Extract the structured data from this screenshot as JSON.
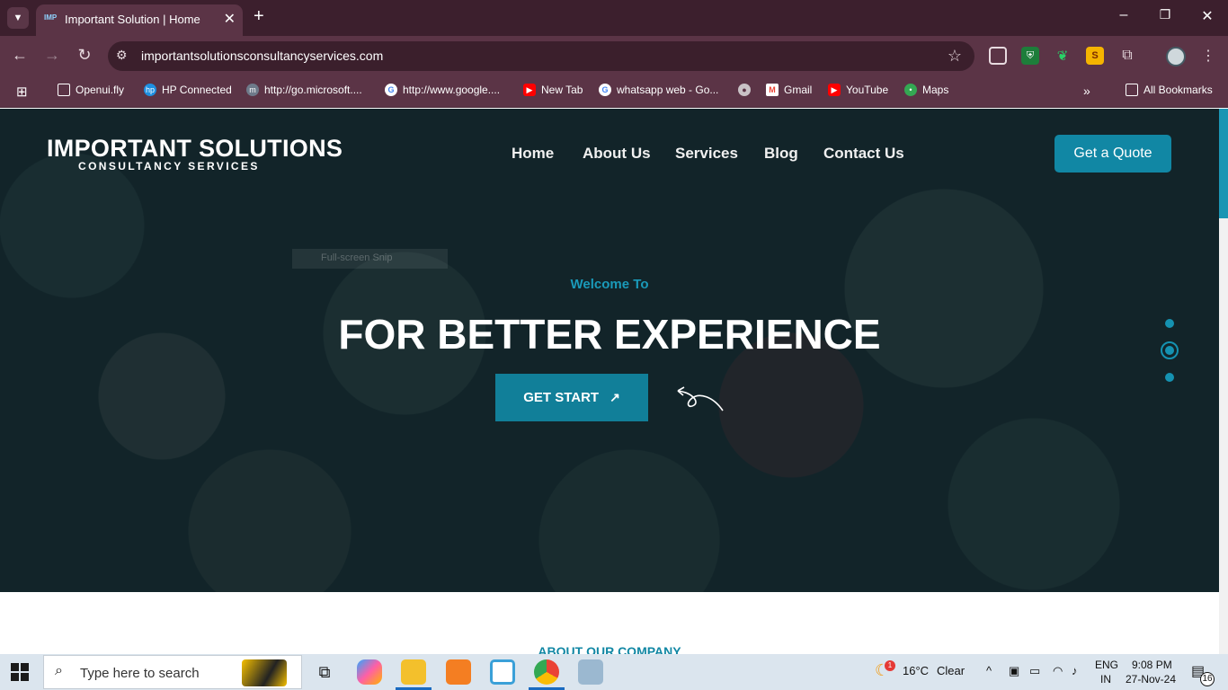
{
  "browser": {
    "tab_title": "Important Solution | Home",
    "tab_favicon": "IMP",
    "url": "importantsolutionsconsultancyservices.com",
    "bookmarks": [
      "Openui.fly",
      "HP Connected",
      "http://go.microsoft....",
      "http://www.google....",
      "New Tab",
      "whatsapp web - Go...",
      "Gmail",
      "YouTube",
      "Maps"
    ],
    "all_bookmarks": "All Bookmarks"
  },
  "site": {
    "logo_main": "IMPORTANT SOLUTIONS",
    "logo_sub": "CONSULTANCY SERVICES",
    "nav": [
      "Home",
      "About Us",
      "Services",
      "Blog",
      "Contact Us"
    ],
    "quote_button": "Get a Quote",
    "ghost_text": "Full-screen Snip",
    "welcome": "Welcome To",
    "headline": "FOR BETTER EXPERIENCE",
    "start_button": "GET START",
    "start_arrow": "↗",
    "about_title": "ABOUT OUR COMPANY",
    "slider_active_index": 1,
    "accent_color": "#1187a4"
  },
  "taskbar": {
    "search_placeholder": "Type here to search",
    "weather_temp": "16°C",
    "weather_text": "Clear",
    "weather_badge": "1",
    "lang_top": "ENG",
    "lang_bottom": "IN",
    "time": "9:08 PM",
    "date": "27-Nov-24",
    "notification_count": "16"
  }
}
